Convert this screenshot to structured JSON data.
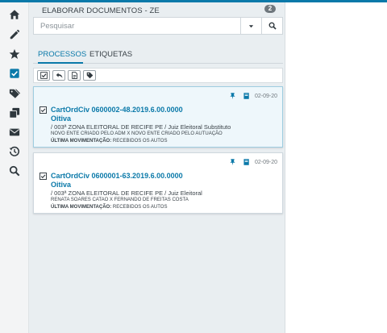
{
  "colors": {
    "accent": "#0a79a9",
    "sidebar_bg": "#f3f4f5",
    "panel_bg": "#e9eef1"
  },
  "sidebar": {
    "items": [
      {
        "icon": "home-icon"
      },
      {
        "icon": "pencil-icon"
      },
      {
        "icon": "star-icon"
      },
      {
        "icon": "checkbox-icon",
        "active": true
      },
      {
        "icon": "tags-icon"
      },
      {
        "icon": "copy-icon"
      },
      {
        "icon": "envelope-icon"
      },
      {
        "icon": "history-icon"
      },
      {
        "icon": "search-icon"
      }
    ]
  },
  "panel": {
    "title": "ELABORAR DOCUMENTOS - ZE",
    "badge": "2",
    "search": {
      "placeholder": "Pesquisar",
      "value": ""
    },
    "tabs": [
      {
        "label": "PROCESSOS",
        "active": true
      },
      {
        "label": "ETIQUETAS",
        "active": false
      }
    ],
    "toolbar": [
      {
        "icon": "select-all-checkbox-icon"
      },
      {
        "icon": "reply-icon"
      },
      {
        "icon": "document-icon"
      },
      {
        "icon": "tag-icon"
      }
    ]
  },
  "processes": [
    {
      "title": "CartOrdCiv 0600002-48.2019.6.00.0000",
      "subtitle": "Oitiva",
      "location": "/ 003ª ZONA ELEITORAL DE RECIFE PE / Juiz Eleitoral Substituto",
      "parties": "NOVO ENTE CRIADO PELO ADM X NOVO ENTE CRIADO PELO AUTUAÇÃO",
      "movement_label": "ÚLTIMA MOVIMENTAÇÃO:",
      "movement_value": "RECEBIDOS OS AUTOS",
      "date": "02-09-20",
      "checked": true,
      "selected": true
    },
    {
      "title": "CartOrdCiv 0600001-63.2019.6.00.0000",
      "subtitle": "Oitiva",
      "location": "/ 003ª ZONA ELEITORAL DE RECIFE PE / Juiz Eleitoral",
      "parties": "RENATA SOARES CATAO X FERNANDO DE FREITAS COSTA",
      "movement_label": "ÚLTIMA MOVIMENTAÇÃO:",
      "movement_value": "RECEBIDOS OS AUTOS",
      "date": "02-09-20",
      "checked": true,
      "selected": false
    }
  ]
}
